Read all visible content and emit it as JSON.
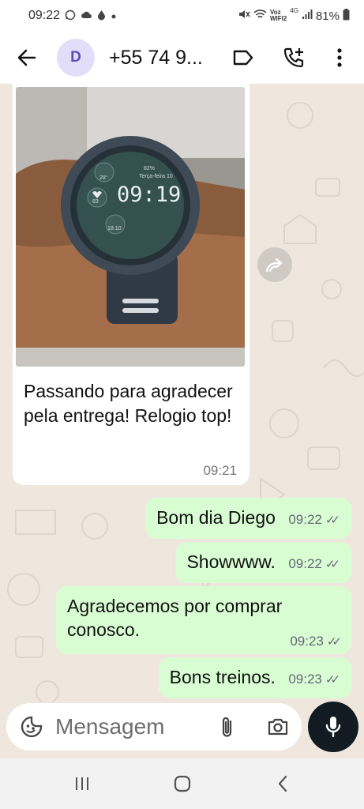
{
  "status_bar": {
    "time": "09:22",
    "network": "Voz",
    "network_sub": "WIFI2",
    "signal_type": "4G",
    "battery": "81%",
    "left_icons": [
      "whatsapp-icon",
      "cloud-icon",
      "drop-icon",
      "dot-icon"
    ],
    "right_icons": [
      "mute-icon",
      "wifi-icon",
      "signal-icon",
      "battery-icon"
    ]
  },
  "header": {
    "avatar_initial": "D",
    "contact_name": "+55 74 9...",
    "icons": [
      "back-arrow-icon",
      "label-icon",
      "add-call-icon",
      "more-vert-icon"
    ]
  },
  "chat": {
    "incoming": {
      "photo": {
        "description_icon": "smartwatch-photo",
        "watch_time": "09:19",
        "watch_date": "Terça-feira 10",
        "watch_battery": "82%",
        "watch_temp": "28°",
        "watch_heart": "83",
        "watch_sunset": "18:10"
      },
      "text": "Passando para agradecer pela entrega! Relogio top!",
      "time": "09:21"
    },
    "outgoing": [
      {
        "text": "Bom dia Diego",
        "time": "09:22"
      },
      {
        "text": "Showwww.",
        "time": "09:22"
      },
      {
        "text": "Agradecemos por comprar conosco.",
        "time": "09:23"
      },
      {
        "text": "Bons treinos.",
        "time": "09:23"
      }
    ]
  },
  "composer": {
    "placeholder": "Mensagem",
    "icons": [
      "emoji-icon",
      "attach-icon",
      "camera-icon",
      "mic-icon"
    ]
  },
  "nav_bar": {
    "icons": [
      "recents-icon",
      "home-icon",
      "back-icon"
    ]
  },
  "colors": {
    "chat_background": "#efe7de",
    "outgoing_bubble": "#d9fdd3",
    "incoming_bubble": "#ffffff",
    "avatar_bg": "#e2defa",
    "mic_button": "#111b21"
  }
}
